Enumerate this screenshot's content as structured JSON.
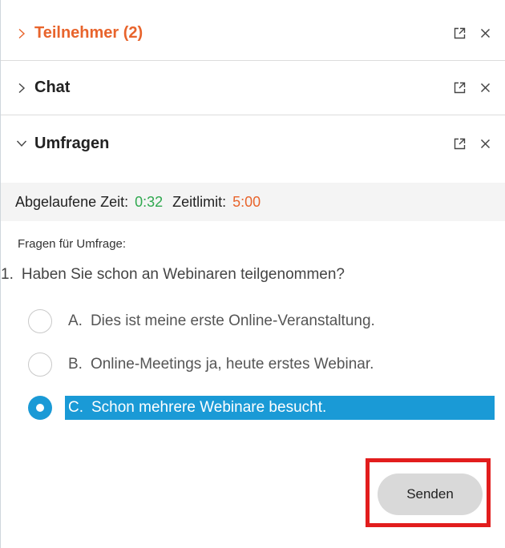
{
  "sections": [
    {
      "title": "Teilnehmer (2)",
      "expanded": false,
      "active": true
    },
    {
      "title": "Chat",
      "expanded": false,
      "active": false
    },
    {
      "title": "Umfragen",
      "expanded": true,
      "active": false
    }
  ],
  "icons": {
    "collapsed": "chevron-right-icon",
    "expanded": "chevron-down-icon",
    "popout": "popout-icon",
    "close": "close-icon"
  },
  "timer": {
    "elapsed_label": "Abgelaufene Zeit:",
    "elapsed_value": "0:32",
    "limit_label": "Zeitlimit:",
    "limit_value": "5:00"
  },
  "poll": {
    "intro": "Fragen für Umfrage:",
    "question_number": "1.",
    "question": "Haben Sie schon an Webinaren teilgenommen?",
    "options": [
      {
        "letter": "A.",
        "text": "Dies ist meine erste Online-Veranstaltung.",
        "selected": false
      },
      {
        "letter": "B.",
        "text": "Online-Meetings ja, heute erstes Webinar.",
        "selected": false
      },
      {
        "letter": "C.",
        "text": "Schon mehrere Webinare besucht.",
        "selected": true
      }
    ],
    "send_label": "Senden"
  },
  "colors": {
    "active_section": "#e8642c",
    "elapsed_time": "#2fa84f",
    "time_limit": "#e8642c",
    "selection": "#1a9ad6",
    "highlight_box": "#e21d1d"
  }
}
